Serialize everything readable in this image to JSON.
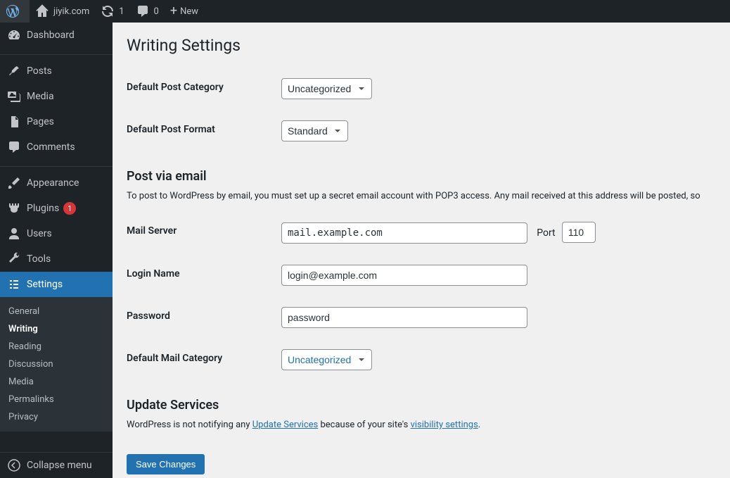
{
  "adminbar": {
    "site_name": "jiyik.com",
    "updates_count": "1",
    "comments_count": "0",
    "new_label": "New"
  },
  "sidebar": {
    "dashboard": "Dashboard",
    "posts": "Posts",
    "media": "Media",
    "pages": "Pages",
    "comments": "Comments",
    "appearance": "Appearance",
    "plugins": "Plugins",
    "plugins_badge": "1",
    "users": "Users",
    "tools": "Tools",
    "settings": "Settings",
    "submenu": {
      "general": "General",
      "writing": "Writing",
      "reading": "Reading",
      "discussion": "Discussion",
      "media": "Media",
      "permalinks": "Permalinks",
      "privacy": "Privacy"
    },
    "collapse": "Collapse menu"
  },
  "page": {
    "title": "Writing Settings",
    "default_category_label": "Default Post Category",
    "default_category_value": "Uncategorized",
    "default_format_label": "Default Post Format",
    "default_format_value": "Standard",
    "post_via_email_heading": "Post via email",
    "post_via_email_desc": "To post to WordPress by email, you must set up a secret email account with POP3 access. Any mail received at this address will be posted, so",
    "mail_server_label": "Mail Server",
    "mail_server_value": "mail.example.com",
    "port_label": "Port",
    "port_value": "110",
    "login_label": "Login Name",
    "login_value": "login@example.com",
    "password_label": "Password",
    "password_value": "password",
    "default_mail_category_label": "Default Mail Category",
    "default_mail_category_value": "Uncategorized",
    "update_services_heading": "Update Services",
    "update_services_prefix": "WordPress is not notifying any ",
    "update_services_link": "Update Services",
    "update_services_mid": " because of your site's ",
    "visibility_link": "visibility settings",
    "update_services_suffix": ".",
    "save_button": "Save Changes"
  }
}
